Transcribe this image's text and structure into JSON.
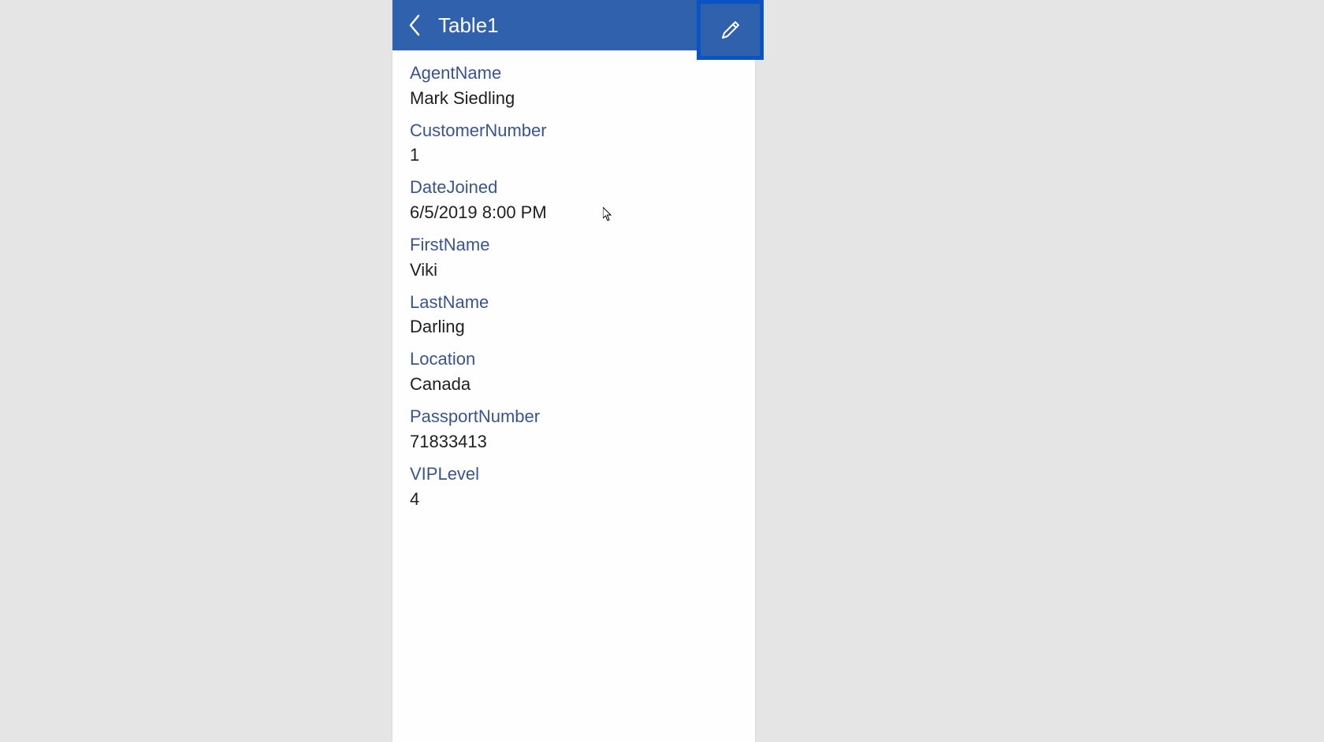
{
  "header": {
    "title": "Table1"
  },
  "fields": [
    {
      "label": "AgentName",
      "value": "Mark Siedling"
    },
    {
      "label": "CustomerNumber",
      "value": "1"
    },
    {
      "label": "DateJoined",
      "value": "6/5/2019 8:00 PM"
    },
    {
      "label": "FirstName",
      "value": "Viki"
    },
    {
      "label": "LastName",
      "value": "Darling"
    },
    {
      "label": "Location",
      "value": "Canada"
    },
    {
      "label": "PassportNumber",
      "value": "71833413"
    },
    {
      "label": "VIPLevel",
      "value": "4"
    }
  ]
}
